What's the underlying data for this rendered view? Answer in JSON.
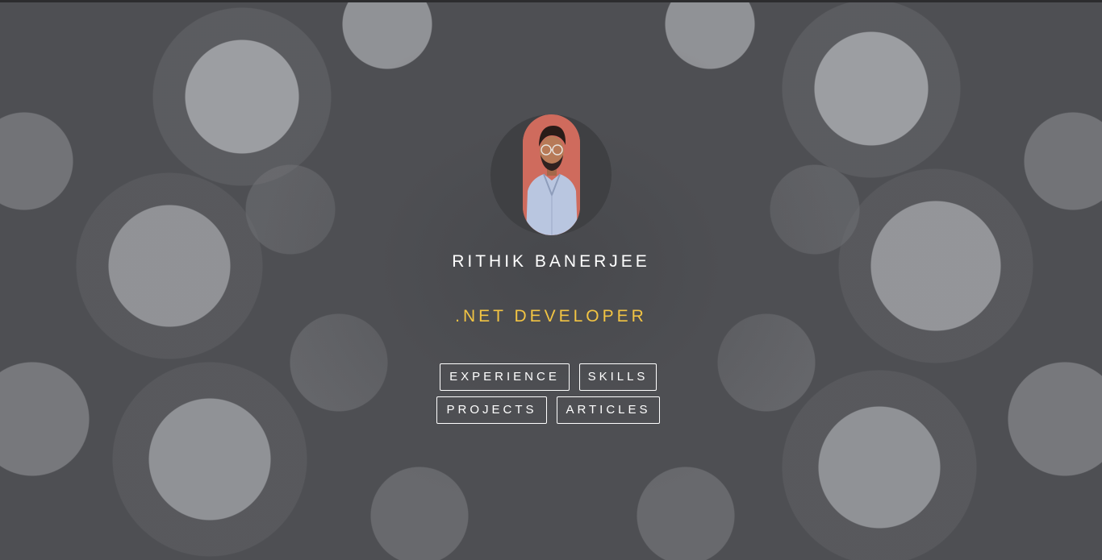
{
  "profile": {
    "name": "RITHIK BANERJEE",
    "role": ".NET DEVELOPER",
    "avatar_icon": "profile-photo"
  },
  "nav": {
    "experience_label": "EXPERIENCE",
    "skills_label": "SKILLS",
    "projects_label": "PROJECTS",
    "articles_label": "ARTICLES"
  },
  "colors": {
    "background": "#4e4f53",
    "name_text": "#ffffff",
    "role_accent": "#f2c443",
    "button_border": "#ffffff"
  }
}
